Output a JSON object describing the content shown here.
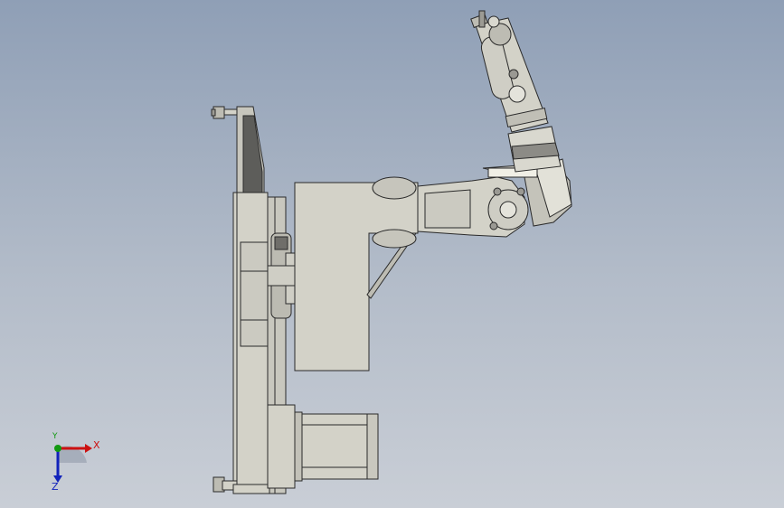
{
  "viewport": {
    "background_top": "#8f9fb6",
    "background_bottom": "#c9ced6",
    "part_fill": "#d3d2c8",
    "edge_color": "#2a2a2a",
    "dark_face": "#5d5d5a"
  },
  "triad": {
    "x_label": "X",
    "y_label": "Y",
    "z_label": "Z",
    "x_color": "#cc1111",
    "y_color": "#119911",
    "z_color": "#1122bb"
  }
}
